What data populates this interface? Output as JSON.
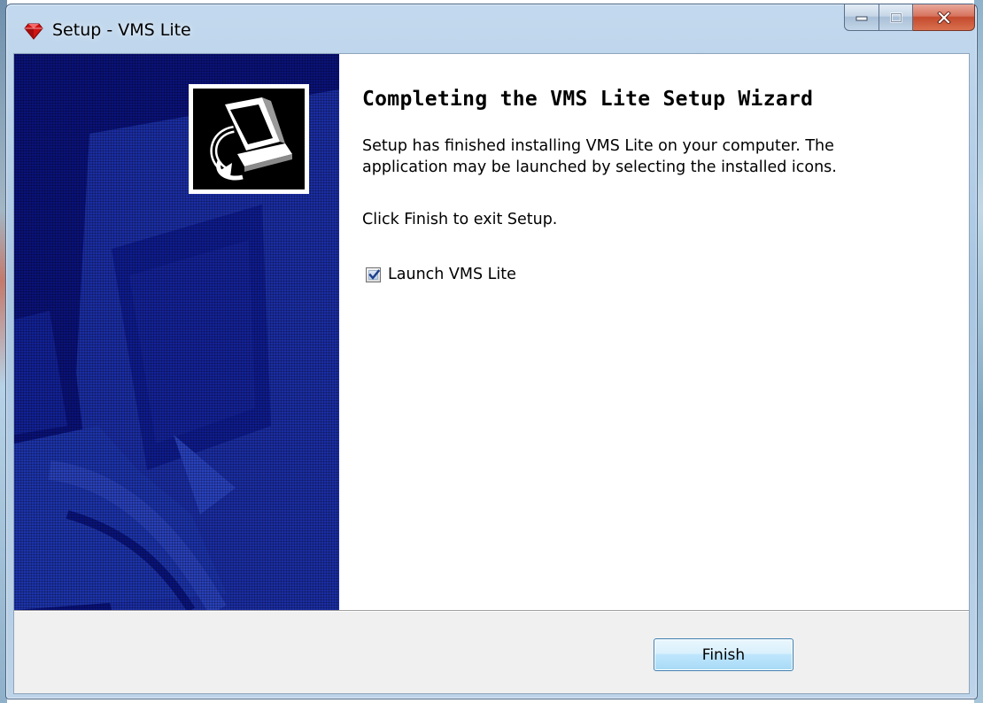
{
  "window": {
    "title": "Setup - VMS Lite",
    "icon": "app-gem-icon"
  },
  "caption_buttons": {
    "minimize_icon": "minimize-icon",
    "maximize_icon": "maximize-icon",
    "close_icon": "close-icon"
  },
  "wizard": {
    "heading": "Completing the VMS Lite Setup Wizard",
    "description_lines": [
      "Setup has finished installing VMS Lite on your computer. The",
      "application may be launched by selecting the installed icons."
    ],
    "instruction": "Click Finish to exit Setup.",
    "launch_checkbox": {
      "label": "Launch VMS Lite",
      "checked": true
    }
  },
  "buttons": {
    "finish_label": "Finish"
  },
  "colors": {
    "banner_blue": "#0a137d",
    "banner_shape": "#1b2fa8",
    "close_red": "#c44a2e"
  }
}
